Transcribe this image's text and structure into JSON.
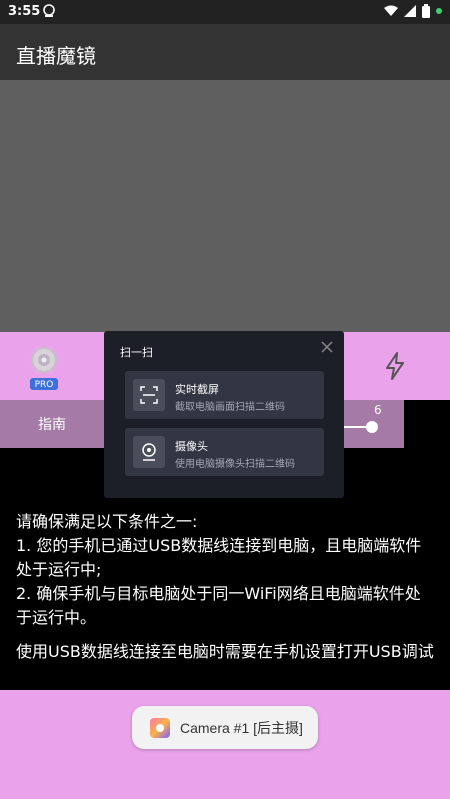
{
  "status_bar": {
    "time": "3:55"
  },
  "app_bar": {
    "title": "直播魔镜"
  },
  "controls": {
    "pro_badge": "PRO",
    "guide_label": "指南",
    "slider_value": "6"
  },
  "scan_popup": {
    "title": "扫一扫",
    "options": [
      {
        "name": "实时截屏",
        "desc": "截取电脑画面扫描二维码"
      },
      {
        "name": "摄像头",
        "desc": "使用电脑摄像头扫描二维码"
      }
    ]
  },
  "info": {
    "heading": "请确保满足以下条件之一:",
    "line1": "1. 您的手机已通过USB数据线连接到电脑，且电脑端软件处于运行中;",
    "line2": "2. 确保手机与目标电脑处于同一WiFi网络且电脑端软件处于运行中。",
    "hint": "使用USB数据线连接至电脑时需要在手机设置打开USB调试"
  },
  "camera_chip": {
    "label": "Camera #1 [后主摄]"
  }
}
